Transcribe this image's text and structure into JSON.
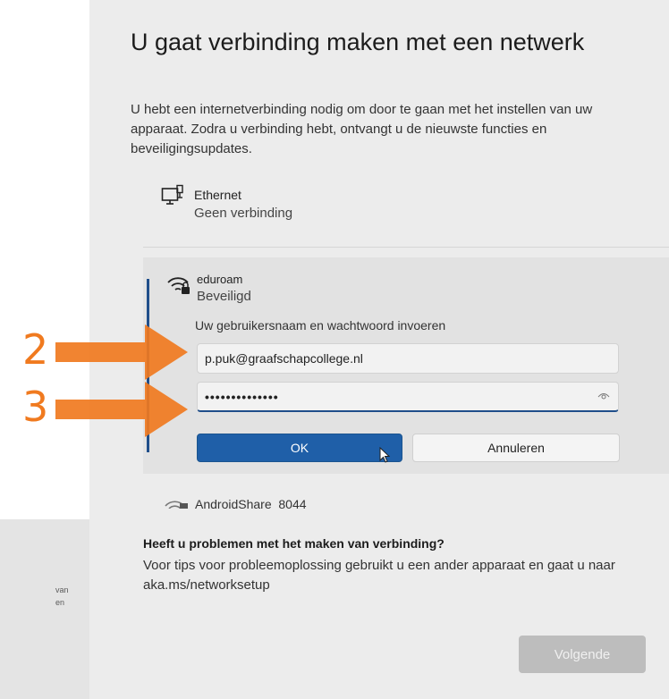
{
  "bg_fragment": {
    "text": "van\nen"
  },
  "header": {
    "title": "U gaat verbinding maken met een netwerk",
    "description": "U hebt een internetverbinding nodig om door te gaan met het instellen van uw apparaat. Zodra u verbinding hebt, ontvangt u de nieuwste functies en beveiligingsupdates."
  },
  "networks": {
    "ethernet": {
      "name": "Ethernet",
      "status": "Geen verbinding",
      "icon": "ethernet-monitor-icon"
    },
    "eduroam": {
      "name": "eduroam",
      "status": "Beveiligd",
      "icon": "wifi-secured-icon",
      "credentials_label": "Uw gebruikersnaam en wachtwoord invoeren",
      "username_value": "p.puk@graafschapcollege.nl",
      "password_masked": "••••••••••••••",
      "ok_label": "OK",
      "cancel_label": "Annuleren"
    },
    "android": {
      "name": "AndroidShare_8044",
      "icon": "wifi-secured-icon"
    }
  },
  "help": {
    "title": "Heeft u problemen met het maken van verbinding?",
    "text": "Voor tips voor probleemoplossing gebruikt u een ander apparaat en gaat u naar aka.ms/networksetup"
  },
  "footer": {
    "next_label": "Volgende"
  },
  "annotations": {
    "step_2": "2",
    "step_3": "3",
    "color": "#f07a1f"
  },
  "colors": {
    "accent": "#1f5fa8",
    "annotation": "#f07a1f",
    "background": "#ececec"
  }
}
